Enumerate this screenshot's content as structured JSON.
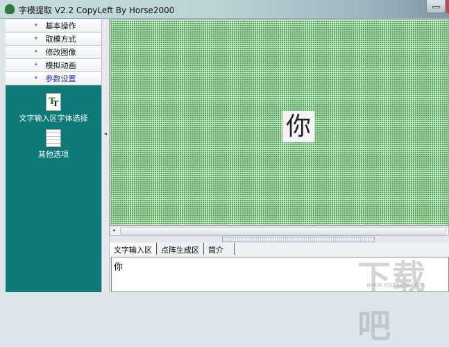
{
  "window": {
    "title": "字模提取 V2.2  CopyLeft By Horse2000"
  },
  "menu": [
    {
      "label": "基本操作"
    },
    {
      "label": "取模方式"
    },
    {
      "label": "修改图像"
    },
    {
      "label": "模拟动画"
    },
    {
      "label": "参数设置",
      "active": true
    }
  ],
  "tools": [
    {
      "label": "文字输入区字体选择",
      "icon": "font-tt-icon"
    },
    {
      "label": "其他选项",
      "icon": "document-icon"
    }
  ],
  "canvas": {
    "glyph": "你"
  },
  "tabs": [
    {
      "label": "文字输入区"
    },
    {
      "label": "点阵生成区"
    },
    {
      "label": "简介"
    }
  ],
  "input": {
    "value": "你"
  },
  "watermark": {
    "text": "下载吧",
    "url_text": "www.xiazaiba.com"
  }
}
